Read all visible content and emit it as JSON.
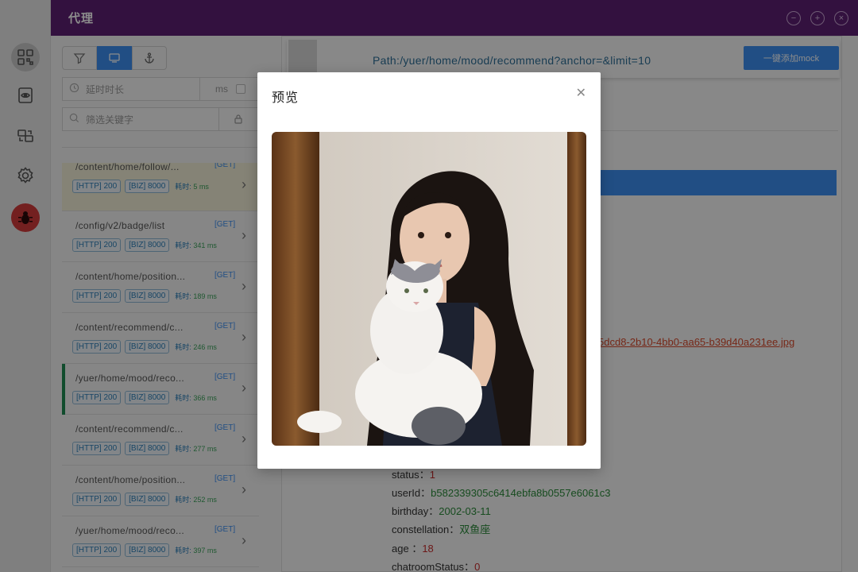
{
  "window": {
    "title": "代理"
  },
  "filters": {
    "delay_placeholder": "延时时长",
    "delay_unit": "ms",
    "keyword_placeholder": "筛选关键字"
  },
  "requests": [
    {
      "path": "/content/home/follow/...",
      "method": "[GET]",
      "http": "[HTTP] 200",
      "biz": "[BIZ] 8000",
      "cost_label": "耗时:",
      "cost": "5 ms"
    },
    {
      "path": "/config/v2/badge/list",
      "method": "[GET]",
      "http": "[HTTP] 200",
      "biz": "[BIZ] 8000",
      "cost_label": "耗时:",
      "cost": "341 ms"
    },
    {
      "path": "/content/home/position...",
      "method": "[GET]",
      "http": "[HTTP] 200",
      "biz": "[BIZ] 8000",
      "cost_label": "耗时:",
      "cost": "189 ms"
    },
    {
      "path": "/content/recommend/c...",
      "method": "[GET]",
      "http": "[HTTP] 200",
      "biz": "[BIZ] 8000",
      "cost_label": "耗时:",
      "cost": "246 ms"
    },
    {
      "path": "/yuer/home/mood/reco...",
      "method": "[GET]",
      "http": "[HTTP] 200",
      "biz": "[BIZ] 8000",
      "cost_label": "耗时:",
      "cost": "366 ms"
    },
    {
      "path": "/content/recommend/c...",
      "method": "[GET]",
      "http": "[HTTP] 200",
      "biz": "[BIZ] 8000",
      "cost_label": "耗时:",
      "cost": "277 ms"
    },
    {
      "path": "/content/home/position...",
      "method": "[GET]",
      "http": "[HTTP] 200",
      "biz": "[BIZ] 8000",
      "cost_label": "耗时:",
      "cost": "252 ms"
    },
    {
      "path": "/yuer/home/mood/reco...",
      "method": "[GET]",
      "http": "[HTTP] 200",
      "biz": "[BIZ] 8000",
      "cost_label": "耗时:",
      "cost": "397 ms"
    }
  ],
  "detail": {
    "path": "Path:/yuer/home/mood/recommend?anchor=&limit=10",
    "mock_button": "一键添加mock",
    "image_url_fragment": "5dcd8-2b10-4bb0-aa65-b39d40a231ee.jpg",
    "fields": [
      {
        "key": "status",
        "sep": "：",
        "value": "1",
        "kind": "num"
      },
      {
        "key": "userId",
        "sep": "：",
        "value": "b582339305c6414ebfa8b0557e6061c3",
        "kind": "str"
      },
      {
        "key": "birthday",
        "sep": "：",
        "value": "2002-03-11",
        "kind": "str"
      },
      {
        "key": "constellation",
        "sep": "：",
        "value": "双鱼座",
        "kind": "str"
      },
      {
        "key": "age",
        "sep": " ：",
        "value": "18",
        "kind": "num"
      },
      {
        "key": "chatroomStatus",
        "sep": "：",
        "value": "0",
        "kind": "num"
      }
    ]
  },
  "modal": {
    "title": "预览",
    "close_icon": "close-icon"
  },
  "colors": {
    "titlebar": "#5e1f73",
    "accent": "#3d8ff0",
    "active_marker": "#1f8a52"
  }
}
